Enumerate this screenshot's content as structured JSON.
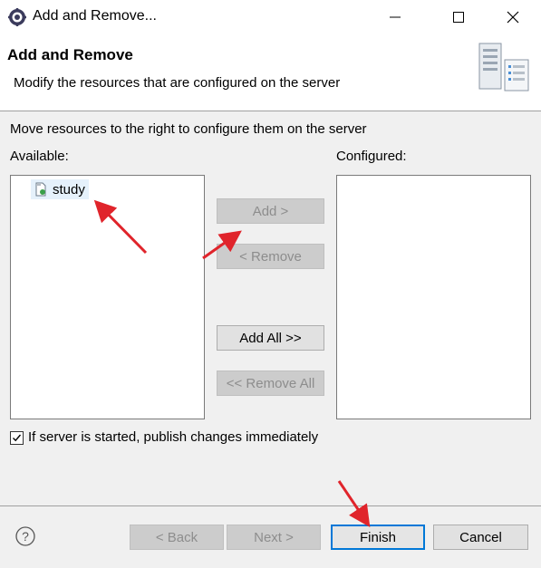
{
  "window": {
    "title": "Add and Remove..."
  },
  "header": {
    "title": "Add and Remove",
    "description": "Modify the resources that are configured on the server"
  },
  "instructions": "Move resources to the right to configure them on the server",
  "available": {
    "label": "Available:",
    "items": [
      "study"
    ]
  },
  "configured": {
    "label": "Configured:",
    "items": []
  },
  "buttons": {
    "add": "Add >",
    "remove": "< Remove",
    "add_all": "Add All >>",
    "remove_all": "<< Remove All"
  },
  "publish_checkbox": {
    "label": "If server is started, publish changes immediately",
    "checked": true
  },
  "footer": {
    "back": "< Back",
    "next": "Next >",
    "finish": "Finish",
    "cancel": "Cancel"
  },
  "colors": {
    "annotation_arrow": "#e0242b",
    "focus_border": "#0078d7",
    "selection": "#e5f1fb"
  },
  "icons": [
    "eclipse-gear-icon",
    "minimize-icon",
    "maximize-icon",
    "close-icon",
    "server-icon",
    "project-icon",
    "checkmark-icon",
    "help-icon"
  ]
}
